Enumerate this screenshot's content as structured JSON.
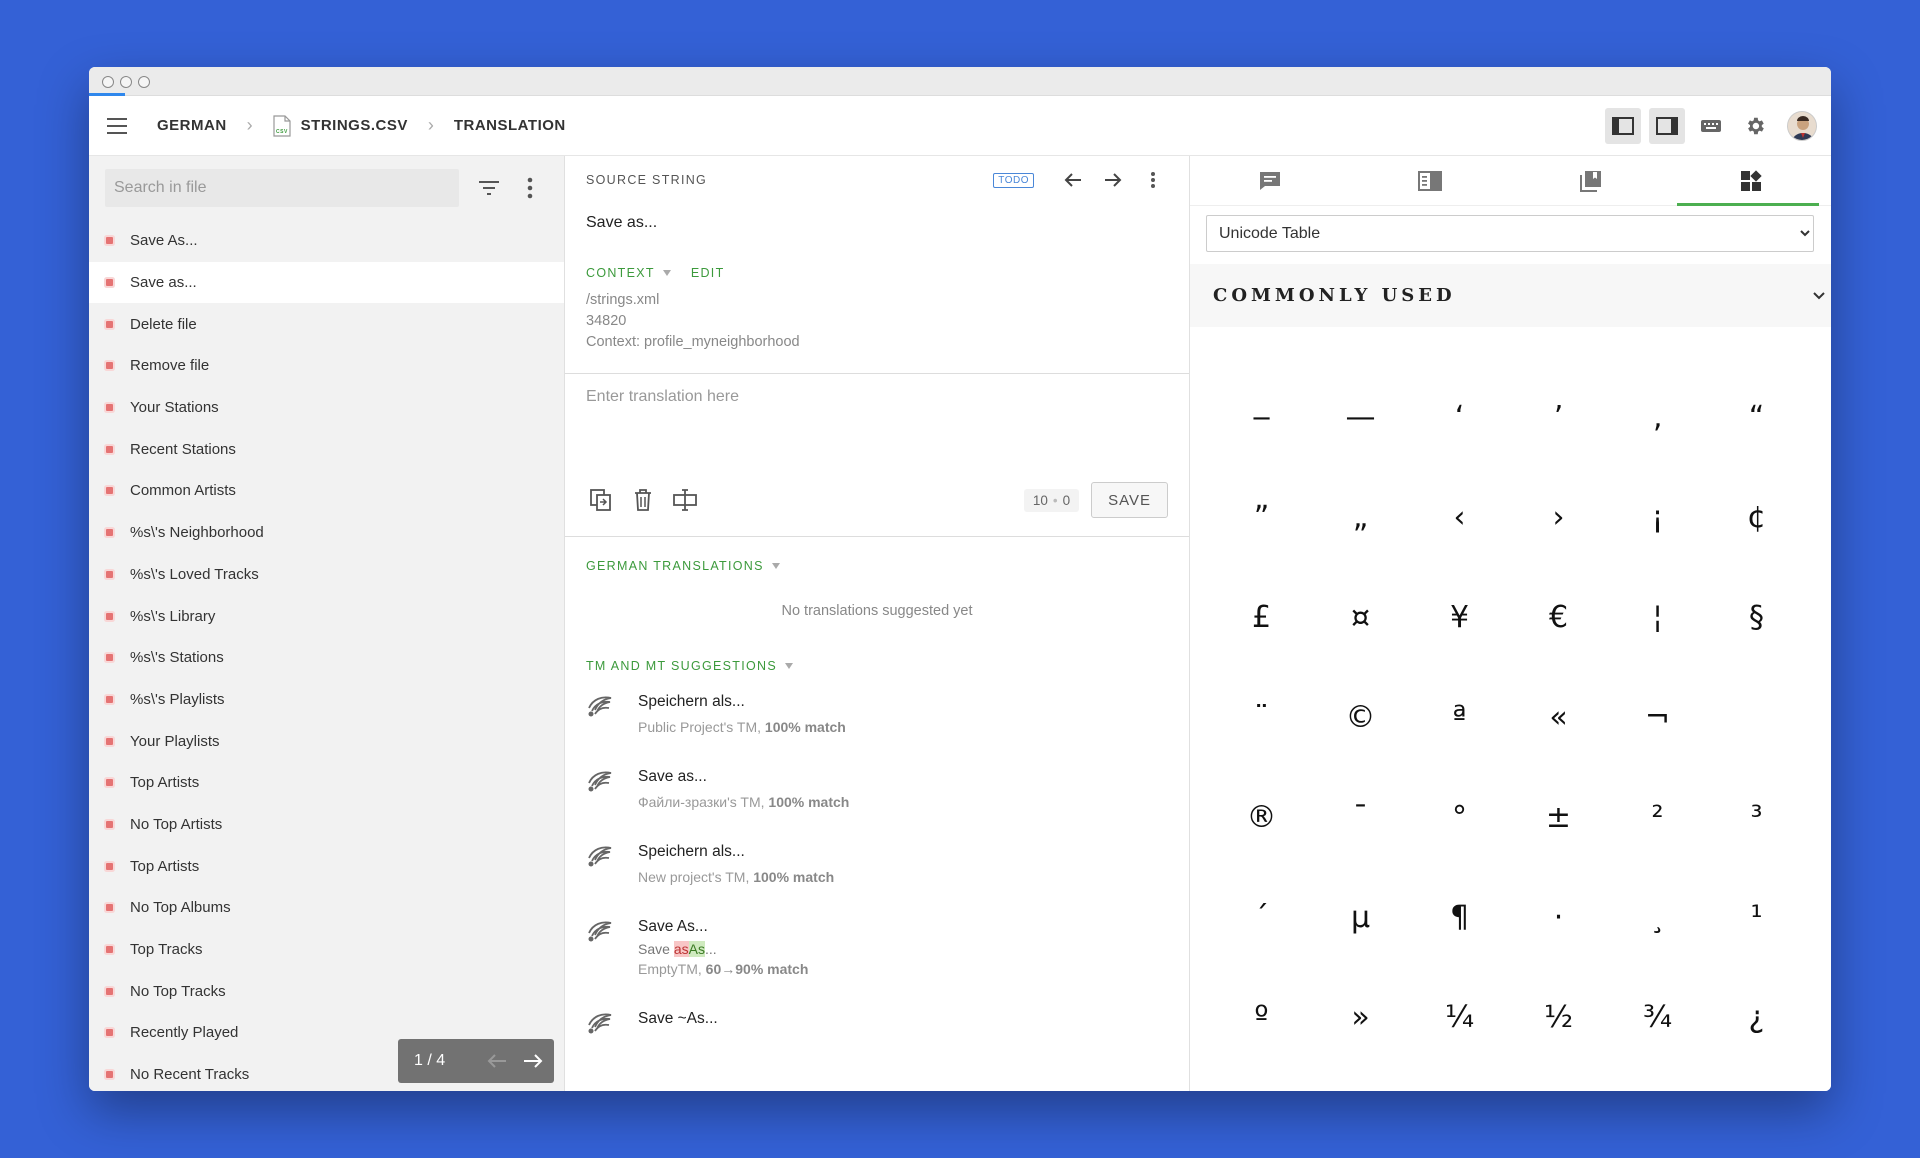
{
  "breadcrumb": {
    "language": "GERMAN",
    "file": "STRINGS.CSV",
    "file_badge": "CSV",
    "view": "TRANSLATION"
  },
  "search": {
    "placeholder": "Search in file"
  },
  "strings": [
    "Save As...",
    "Save as...",
    "Delete file",
    "Remove file",
    "Your Stations",
    "Recent Stations",
    "Common Artists",
    "%s\\'s Neighborhood",
    "%s\\'s Loved Tracks",
    "%s\\'s Library",
    "%s\\'s Stations",
    "%s\\'s Playlists",
    "Your Playlists",
    "Top Artists",
    "No Top Artists",
    "Top Artists",
    "No Top Albums",
    "Top Tracks",
    "No Top Tracks",
    "Recently Played",
    "No Recent Tracks"
  ],
  "pager": {
    "text": "1 / 4"
  },
  "source": {
    "label": "SOURCE STRING",
    "status_badge": "TODO",
    "text": "Save as...",
    "context_label": "CONTEXT",
    "edit_label": "EDIT",
    "context_lines": [
      "/strings.xml",
      "34820",
      "Context: profile_myneighborhood"
    ]
  },
  "editor": {
    "placeholder": "Enter translation here",
    "source_count": "10",
    "target_count": "0",
    "save_label": "SAVE"
  },
  "translations": {
    "label": "GERMAN TRANSLATIONS",
    "empty": "No translations suggested yet"
  },
  "suggestions": {
    "label": "TM AND MT SUGGESTIONS",
    "items": [
      {
        "text": "Speichern als...",
        "source": "Public Project's TM, ",
        "match": "100% match"
      },
      {
        "text": "Save as...",
        "source": "Файли-зразки's TM, ",
        "match": "100% match"
      },
      {
        "text": "Speichern als...",
        "source": "New project's TM, ",
        "match": "100% match"
      },
      {
        "text": "Save As...",
        "diff_prefix": "Save ",
        "diff_del": "as",
        "diff_ins": "As",
        "diff_suffix": "...",
        "source": "EmptyTM, ",
        "match": "60→90% match"
      },
      {
        "text": "Save ~As..."
      }
    ]
  },
  "right_panel": {
    "select_value": "Unicode Table",
    "category_title": "COMMONLY USED",
    "characters": [
      "‒",
      "—",
      "‘",
      "’",
      "‚",
      "“",
      "”",
      "„",
      "‹",
      "›",
      "¡",
      "¢",
      "£",
      "¤",
      "¥",
      "€",
      "¦",
      "§",
      "¨",
      "©",
      "ª",
      "«",
      "¬",
      "",
      "®",
      "¯",
      "°",
      "±",
      "²",
      "³",
      "´",
      "µ",
      "¶",
      "·",
      "¸",
      "¹",
      "º",
      "»",
      "¼",
      "½",
      "¾",
      "¿"
    ]
  },
  "colors": {
    "background": "#3461d6",
    "accent_green": "#3c9a3c",
    "todo_blue": "#4a87d8",
    "untranslated_red": "#e57373"
  }
}
